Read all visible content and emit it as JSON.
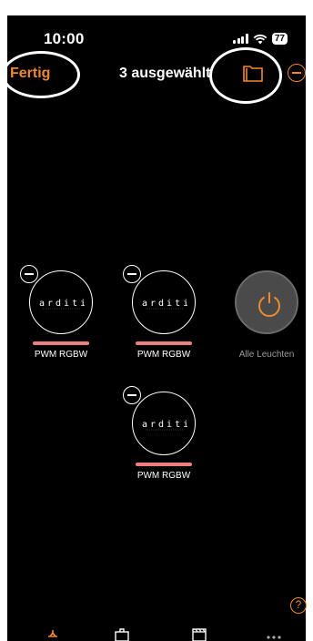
{
  "status": {
    "time": "10:00",
    "battery": "77"
  },
  "nav": {
    "done_label": "Fertig",
    "title": "3 ausgewählt"
  },
  "tiles": [
    {
      "label": "PWM RGBW"
    },
    {
      "label": "PWM RGBW"
    },
    {
      "label": "Alle Leuchten"
    },
    {
      "label": "PWM RGBW"
    }
  ],
  "help": {
    "label": "?"
  },
  "colors": {
    "accent": "#f0892e",
    "bar": "#f08080",
    "background": "#000000"
  }
}
